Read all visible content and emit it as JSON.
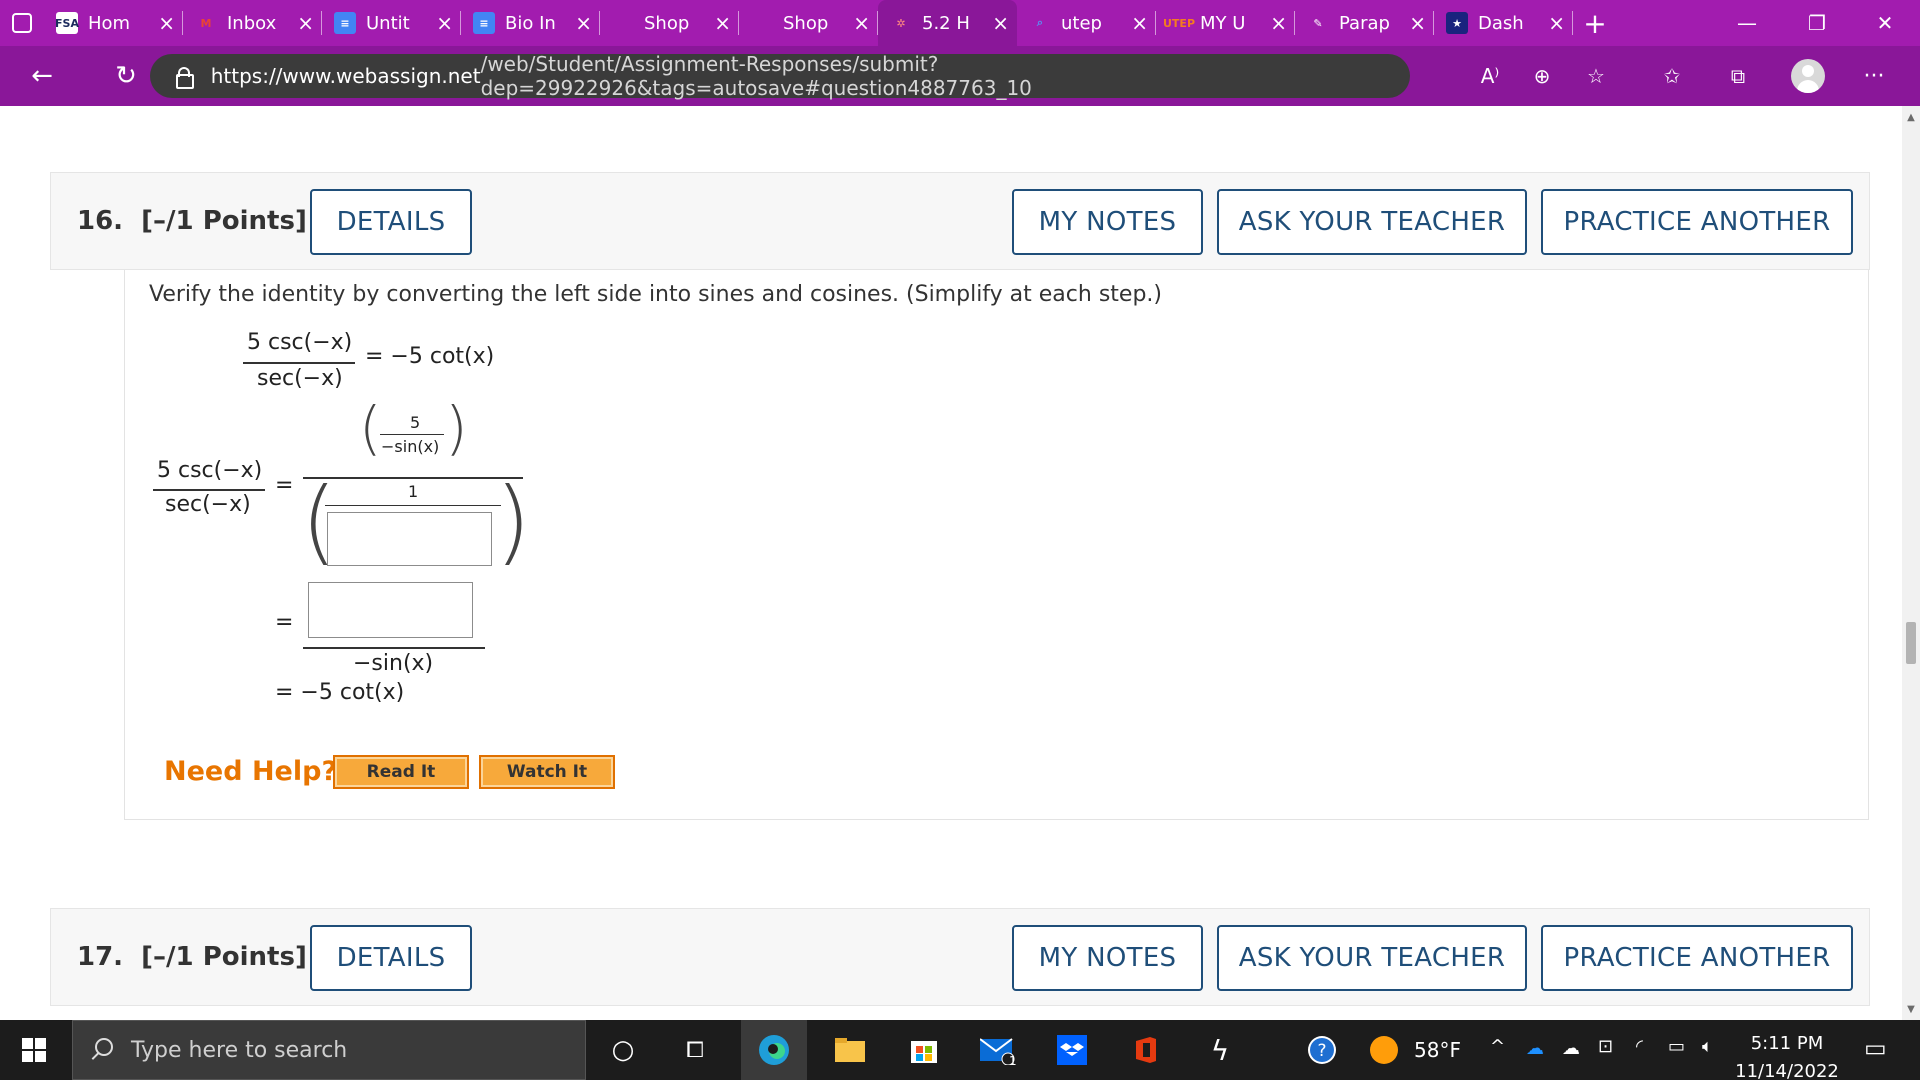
{
  "browser": {
    "tabs": [
      {
        "label": "Hom",
        "favicon": "FSA",
        "favicon_bg": "#ffffff",
        "favicon_fg": "#1b2a5c",
        "icon_name": "fsa-favicon-icon",
        "active": false
      },
      {
        "label": "Inbox",
        "favicon": "M",
        "favicon_bg": "transparent",
        "favicon_fg": "#ea4335",
        "icon_name": "gmail-favicon-icon",
        "active": false
      },
      {
        "label": "Untit",
        "favicon": "≡",
        "favicon_bg": "#4285f4",
        "favicon_fg": "#ffffff",
        "icon_name": "google-docs-icon",
        "active": false
      },
      {
        "label": "Bio In",
        "favicon": "≡",
        "favicon_bg": "#4285f4",
        "favicon_fg": "#ffffff",
        "icon_name": "google-docs-icon",
        "active": false
      },
      {
        "label": "Shop",
        "favicon": "",
        "favicon_bg": "transparent",
        "favicon_fg": "#ffffff",
        "icon_name": "shop-favicon-icon",
        "active": false
      },
      {
        "label": "Shop",
        "favicon": "",
        "favicon_bg": "transparent",
        "favicon_fg": "#ffffff",
        "icon_name": "shop-favicon-icon",
        "active": false
      },
      {
        "label": "5.2 H",
        "favicon": "✲",
        "favicon_bg": "transparent",
        "favicon_fg": "#ff8a80",
        "icon_name": "webassign-favicon-icon",
        "active": true
      },
      {
        "label": "utep",
        "favicon": "⌕",
        "favicon_bg": "transparent",
        "favicon_fg": "#5b8def",
        "icon_name": "search-favicon-icon",
        "active": false
      },
      {
        "label": "MY U",
        "favicon": "UTEP",
        "favicon_bg": "transparent",
        "favicon_fg": "#f47b20",
        "icon_name": "utep-favicon-icon",
        "active": false
      },
      {
        "label": "Parap",
        "favicon": "✎",
        "favicon_bg": "transparent",
        "favicon_fg": "#ffffff",
        "icon_name": "pen-favicon-icon",
        "active": false
      },
      {
        "label": "Dash",
        "favicon": "★",
        "favicon_bg": "#1a237e",
        "favicon_fg": "#ffffff",
        "icon_name": "dashboard-favicon-icon",
        "active": false
      }
    ],
    "url_host": "https://www.webassign.net",
    "url_rest": "/web/Student/Assignment-Responses/submit?dep=29922926&tags=autosave#question4887763_10"
  },
  "question16": {
    "number": "16.",
    "points": "[–/1 Points]",
    "details_label": "DETAILS",
    "my_notes_label": "MY NOTES",
    "ask_teacher_label": "ASK YOUR TEACHER",
    "practice_label": "PRACTICE ANOTHER",
    "prompt": "Verify the identity by converting the left side into sines and cosines. (Simplify at each step.)",
    "identity_numerator": "5 csc(−x)",
    "identity_denominator": "sec(−x)",
    "identity_rhs": "= −5 cot(x)",
    "step_lhs_numerator": "5 csc(−x)",
    "step_lhs_denominator": "sec(−x)",
    "equals": "=",
    "inner_top_numerator": "5",
    "inner_top_denominator": "−sin(x)",
    "inner_bottom_numerator": "1",
    "inner_bottom_answer": "",
    "step2_answer": "",
    "step2_denominator": "−sin(x)",
    "final": "= −5 cot(x)",
    "need_help": "Need Help?",
    "read_it": "Read It",
    "watch_it": "Watch It"
  },
  "question17": {
    "number": "17.",
    "points": "[–/1 Points]",
    "details_label": "DETAILS",
    "my_notes_label": "MY NOTES",
    "ask_teacher_label": "ASK YOUR TEACHER",
    "practice_label": "PRACTICE ANOTHER"
  },
  "taskbar": {
    "search_placeholder": "Type here to search",
    "weather": "58°F",
    "time": "5:11 PM",
    "date": "11/14/2022",
    "mail_badge": "1"
  },
  "colors": {
    "browser_frame": "#a21caf",
    "link_blue": "#1f4e79",
    "need_help_orange": "#e87500"
  }
}
